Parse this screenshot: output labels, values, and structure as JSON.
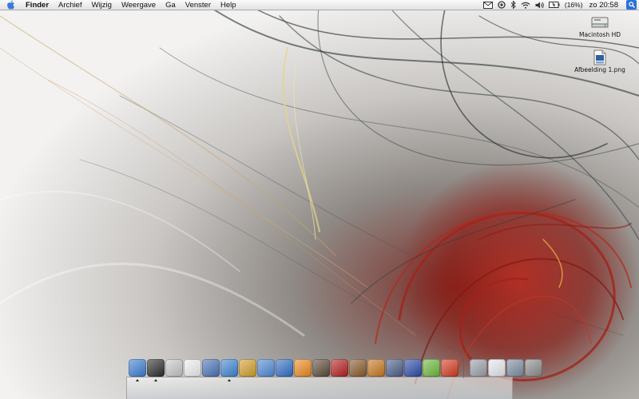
{
  "menubar": {
    "apple_icon": "apple-icon",
    "items": [
      "Finder",
      "Archief",
      "Wijzig",
      "Weergave",
      "Ga",
      "Venster",
      "Help"
    ],
    "status": {
      "icons": [
        "mail-icon",
        "sync-icon",
        "bluetooth-icon",
        "wifi-icon",
        "volume-icon",
        "battery-icon"
      ],
      "battery_percent": "(16%)",
      "clock": "zo 20:58",
      "spotlight_icon": "spotlight-search-icon"
    }
  },
  "desktop": {
    "icons": [
      {
        "label": "Macintosh HD",
        "icon": "hard-drive-icon"
      },
      {
        "label": "Afbeelding 1.png",
        "icon": "png-file-icon"
      }
    ]
  },
  "dock": {
    "apps": [
      {
        "icon": "finder-icon",
        "color": "#3b7fd6",
        "running": true
      },
      {
        "icon": "dashboard-icon",
        "color": "#2b2b2b",
        "running": true
      },
      {
        "icon": "mail-app-icon",
        "color": "#c9c9c9",
        "running": false
      },
      {
        "icon": "ipod-icon",
        "color": "#f2f2f2",
        "running": false
      },
      {
        "icon": "address-book-icon",
        "color": "#4a73b8",
        "running": false
      },
      {
        "icon": "safari-icon",
        "color": "#3d86d6",
        "running": true
      },
      {
        "icon": "people-icon",
        "color": "#d6a02a",
        "running": false
      },
      {
        "icon": "itunes-icon",
        "color": "#4d8ad8",
        "running": false
      },
      {
        "icon": "quicktime-icon",
        "color": "#2f6fc8",
        "running": false
      },
      {
        "icon": "vlc-icon",
        "color": "#f08a1c",
        "running": false
      },
      {
        "icon": "iphoto-icon",
        "color": "#5b4a36",
        "running": false
      },
      {
        "icon": "photo-booth-icon",
        "color": "#b81c1c",
        "running": false
      },
      {
        "icon": "garageband-icon",
        "color": "#8a5a2a",
        "running": false
      },
      {
        "icon": "chess-icon",
        "color": "#c8781e",
        "running": false
      },
      {
        "icon": "keyboard-icon",
        "color": "#4a5f8a",
        "running": false
      },
      {
        "icon": "automator-icon",
        "color": "#2a4aa8",
        "running": false
      },
      {
        "icon": "dreamweaver-icon",
        "color": "#6dbb3a",
        "running": false
      },
      {
        "icon": "flash-icon",
        "color": "#d63a1e",
        "running": false
      }
    ],
    "others": [
      {
        "icon": "downloads-stack-icon",
        "color": "#9aa2aa"
      },
      {
        "icon": "documents-stack-icon",
        "color": "#e8ecf0"
      },
      {
        "icon": "applications-stack-icon",
        "color": "#7c8ea2"
      },
      {
        "icon": "trash-icon",
        "color": "#8d8d8d"
      }
    ]
  },
  "colors": {
    "wallpaper_red": "#9a1712",
    "wallpaper_dark": "#2d3a36",
    "wallpaper_gold": "#c9a34a"
  }
}
